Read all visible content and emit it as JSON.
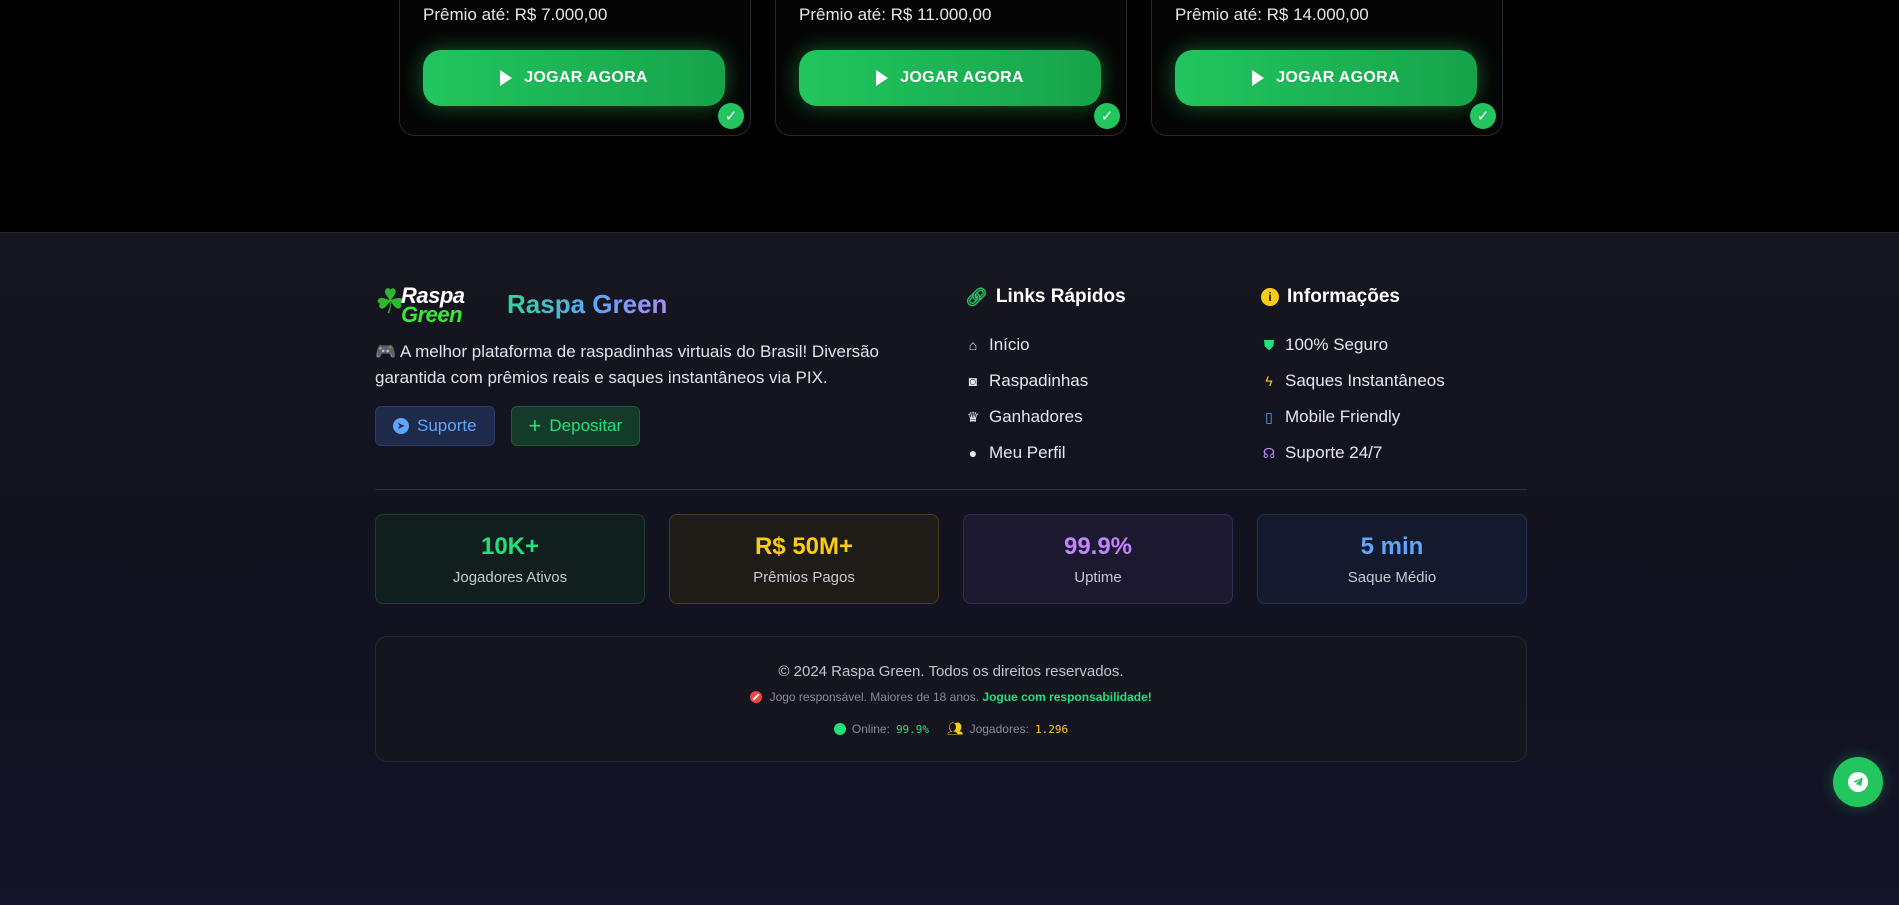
{
  "cards": [
    {
      "prize": "Prêmio até: R$ 7.000,00",
      "button": "JOGAR AGORA",
      "check": "✓"
    },
    {
      "prize": "Prêmio até: R$ 11.000,00",
      "button": "JOGAR AGORA",
      "check": "✓"
    },
    {
      "prize": "Prêmio até: R$ 14.000,00",
      "button": "JOGAR AGORA",
      "check": "✓"
    }
  ],
  "footer": {
    "logo_line1": "Raspa",
    "logo_line2": "Green",
    "brand_name": "Raspa Green",
    "description": "🎮 A melhor plataforma de raspadinhas virtuais do Brasil! Diversão garantida com prêmios reais e saques instantâneos via PIX.",
    "support_button": "Suporte",
    "deposit_button": "Depositar",
    "links": {
      "title": "Links Rápidos",
      "items": [
        {
          "label": "Início",
          "icon": "home-icon"
        },
        {
          "label": "Raspadinhas",
          "icon": "gamepad-icon"
        },
        {
          "label": "Ganhadores",
          "icon": "trophy-icon"
        },
        {
          "label": "Meu Perfil",
          "icon": "user-icon"
        }
      ]
    },
    "info": {
      "title": "Informações",
      "items": [
        {
          "label": "100% Seguro",
          "icon": "shield-icon"
        },
        {
          "label": "Saques Instantâneos",
          "icon": "lightning-icon"
        },
        {
          "label": "Mobile Friendly",
          "icon": "mobile-icon"
        },
        {
          "label": "Suporte 24/7",
          "icon": "headset-icon"
        }
      ]
    },
    "stats": [
      {
        "value": "10K+",
        "label": "Jogadores Ativos",
        "color": "#22e07a"
      },
      {
        "value": "R$ 50M+",
        "label": "Prêmios Pagos",
        "color": "#facc15"
      },
      {
        "value": "99.9%",
        "label": "Uptime",
        "color": "#c084fc"
      },
      {
        "value": "5 min",
        "label": "Saque Médio",
        "color": "#60a5fa"
      }
    ],
    "copyright": "© 2024 Raspa Green. Todos os direitos reservados.",
    "responsible_text": "Jogo responsável. Maiores de 18 anos.",
    "responsible_link": "Jogue com responsabilidade!",
    "online_label": "Online:",
    "online_value": "99.9%",
    "players_label": "Jogadores:",
    "players_value": "1.296"
  },
  "colors": {
    "accent_green": "#22c55e",
    "accent_blue": "#60a5fa",
    "accent_yellow": "#facc15",
    "accent_purple": "#c084fc"
  }
}
